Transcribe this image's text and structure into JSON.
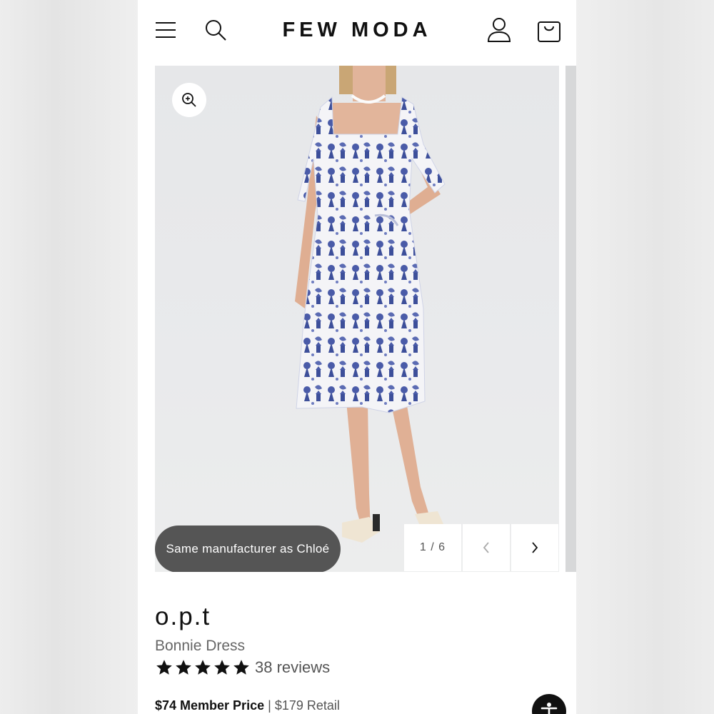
{
  "header": {
    "brand": "FEW MODA",
    "icons": [
      "hamburger-menu-icon",
      "search-icon",
      "account-icon",
      "shopping-bag-icon"
    ]
  },
  "gallery": {
    "image_alt": "Model wearing blue and white toile print midi dress",
    "badge": "Same manufacturer as Chloé",
    "counter": "1 / 6",
    "current_slide": 1,
    "total_slides": 6,
    "colors": {
      "dress_blue": "#3d4f9a",
      "badge_bg": "#555555"
    }
  },
  "product": {
    "brand": "o.p.t",
    "name": "Bonnie Dress",
    "rating": 5,
    "rating_max": 5,
    "reviews": "38 reviews",
    "member_price": "$74 Member Price",
    "separator": "|",
    "retail_price": "$179 Retail"
  }
}
